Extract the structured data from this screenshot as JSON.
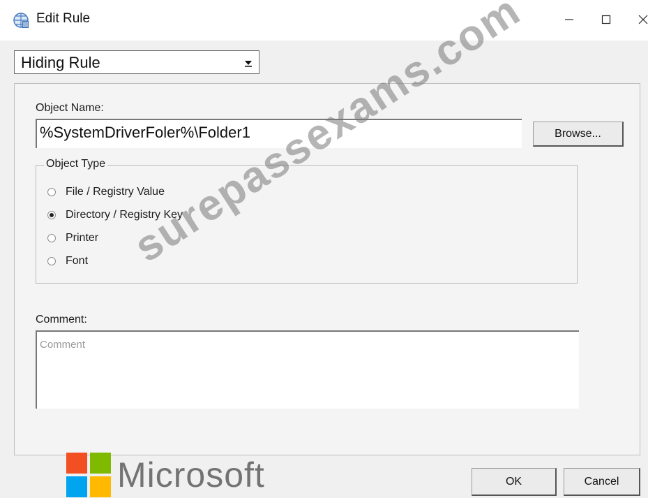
{
  "window": {
    "title": "Edit Rule",
    "controls": {
      "minimize": "minimize-icon",
      "maximize": "maximize-icon",
      "close": "close-icon"
    }
  },
  "rule_type": {
    "selected": "Hiding Rule"
  },
  "object_name": {
    "label": "Object Name:",
    "value": "%SystemDriverFoler%\\Folder1"
  },
  "browse_label": "Browse...",
  "object_type": {
    "legend": "Object Type",
    "options": [
      {
        "label": "File / Registry Value",
        "selected": false
      },
      {
        "label": "Directory / Registry Key",
        "selected": true
      },
      {
        "label": "Printer",
        "selected": false
      },
      {
        "label": "Font",
        "selected": false
      }
    ]
  },
  "comment": {
    "label": "Comment:",
    "placeholder": "Comment"
  },
  "buttons": {
    "ok": "OK",
    "cancel": "Cancel"
  },
  "branding": {
    "logo_text": "Microsoft",
    "watermark": "surepassexams.com"
  },
  "colors": {
    "ms_red": "#f25022",
    "ms_green": "#7fba00",
    "ms_blue": "#00a4ef",
    "ms_yellow": "#ffb900"
  }
}
